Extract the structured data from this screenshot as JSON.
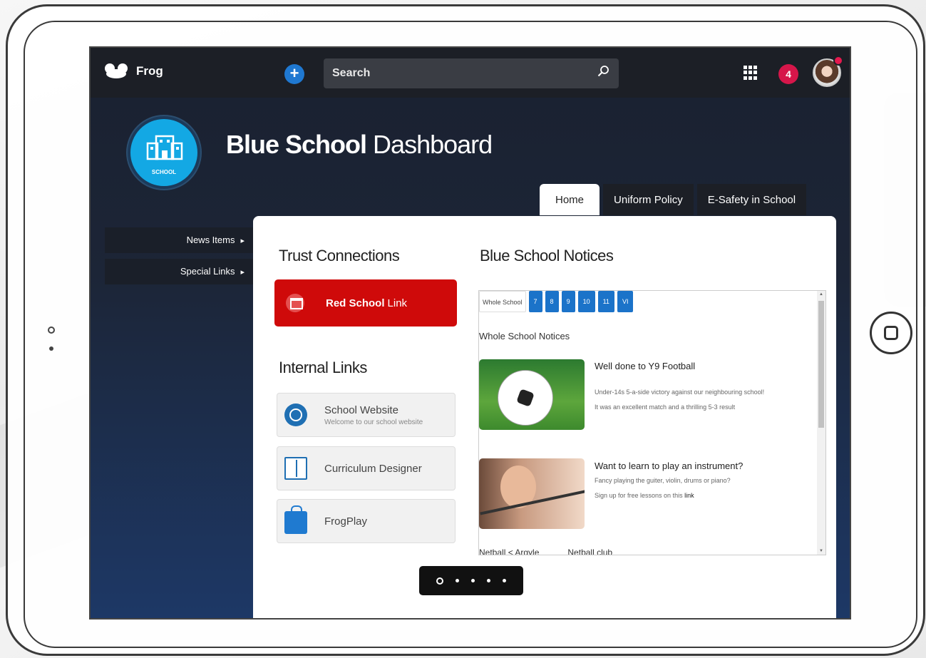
{
  "topbar": {
    "brand": "Frog",
    "add_label": "+",
    "search_placeholder": "Search",
    "notification_count": "4"
  },
  "hero": {
    "school_badge_label": "SCHOOL",
    "title_bold": "Blue School",
    "title_rest": "Dashboard"
  },
  "tabs": [
    {
      "label": "Home",
      "active": true
    },
    {
      "label": "Uniform Policy",
      "active": false
    },
    {
      "label": "E-Safety in School",
      "active": false
    }
  ],
  "sidebar": {
    "items": [
      {
        "label": "News Items"
      },
      {
        "label": "Special Links"
      }
    ]
  },
  "trust": {
    "heading": "Trust Connections",
    "red_link_bold": "Red School",
    "red_link_rest": "Link"
  },
  "internal": {
    "heading": "Internal Links",
    "links": [
      {
        "title": "School Website",
        "subtitle": "Welcome to our school website",
        "icon": "globe-icon"
      },
      {
        "title": "Curriculum Designer",
        "subtitle": "",
        "icon": "book-icon"
      },
      {
        "title": "FrogPlay",
        "subtitle": "",
        "icon": "frogplay-icon"
      }
    ]
  },
  "notices": {
    "heading": "Blue School Notices",
    "tabs": [
      "Whole School",
      "7",
      "8",
      "9",
      "10",
      "11",
      "VI"
    ],
    "section_title": "Whole School Notices",
    "items": [
      {
        "title": "Well done to Y9 Football",
        "line1": "Under-14s 5-a-side victory against our neighbouring school!",
        "line2": "It was an excellent match and a thrilling 5-3 result"
      },
      {
        "title": "Want to learn to play an instrument?",
        "line1": "Fancy playing the guiter, violin, drums or piano?",
        "line2": "Sign up for free lessons on this",
        "link": "link"
      }
    ],
    "partial_alt": "Netball < Argyle",
    "partial_title": "Netball club"
  },
  "pager": {
    "pages": 5,
    "active": 0
  },
  "colors": {
    "accent": "#1b73c9",
    "red": "#cf0a0a",
    "badge": "#d6164a",
    "school_blue": "#13a8e4"
  }
}
